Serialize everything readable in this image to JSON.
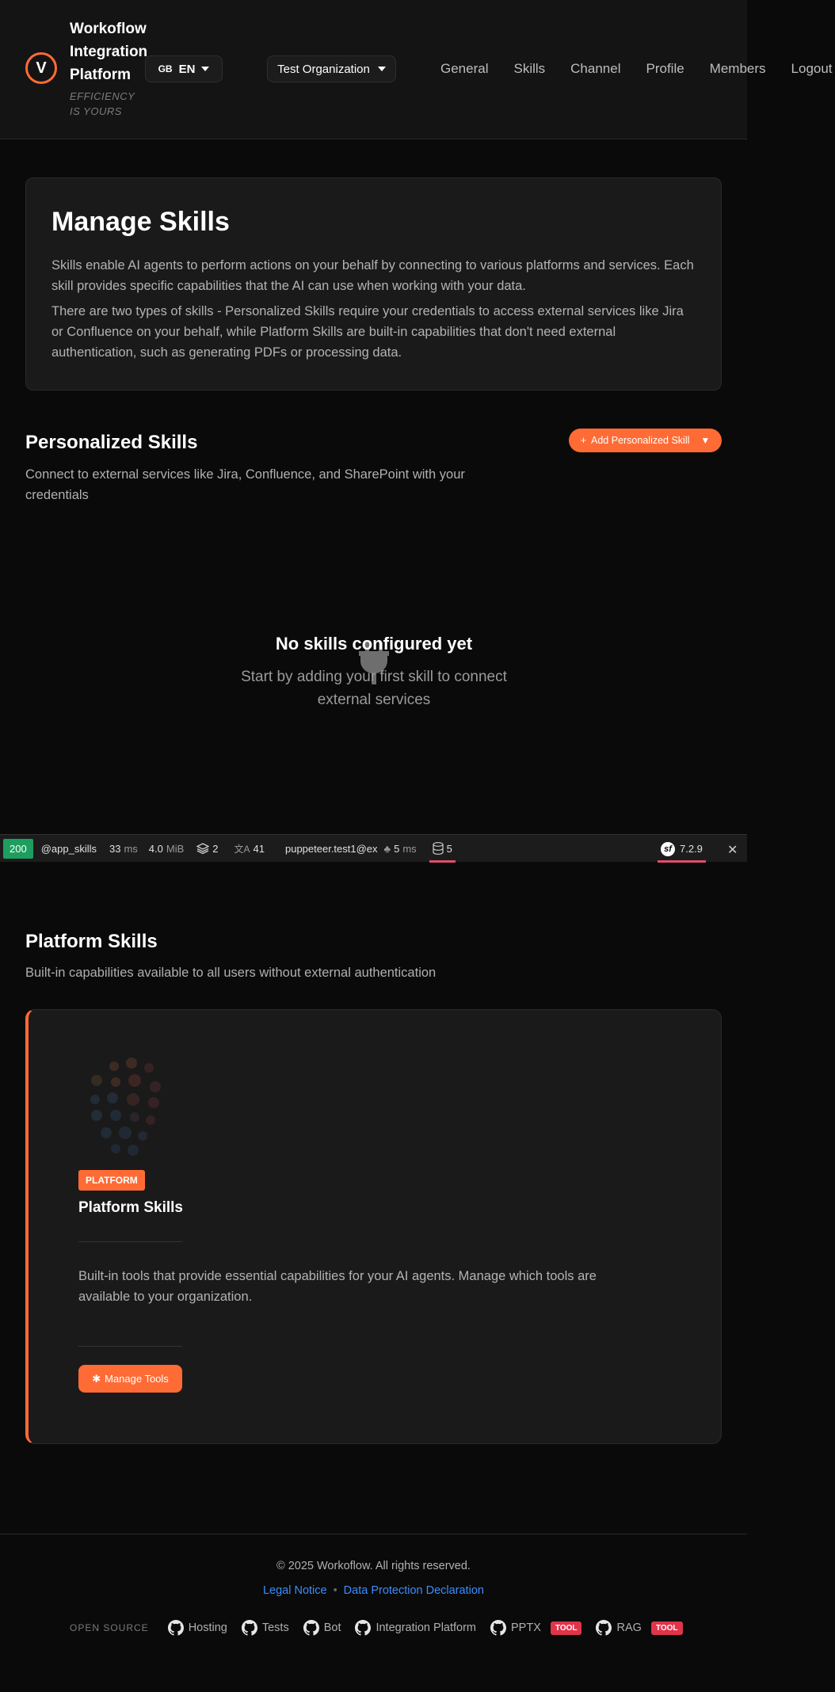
{
  "header": {
    "logo_letter": "V",
    "brand": "Workoflow Integration Platform",
    "tagline": "EFFICIENCY IS YOURS",
    "language": {
      "flag": "GB",
      "code": "EN"
    },
    "organization": "Test Organization",
    "nav": [
      "General",
      "Skills",
      "Channel",
      "Profile",
      "Members",
      "Logout"
    ]
  },
  "intro": {
    "title": "Manage Skills",
    "p1": "Skills enable AI agents to perform actions on your behalf by connecting to various platforms and services. Each skill provides specific capabilities that the AI can use when working with your data.",
    "p2": "There are two types of skills - Personalized Skills require your credentials to access external services like Jira or Confluence on your behalf, while Platform Skills are built-in capabilities that don't need external authentication, such as generating PDFs or processing data."
  },
  "personalized": {
    "title": "Personalized Skills",
    "description": "Connect to external services like Jira, Confluence, and SharePoint with your credentials",
    "add_button": "Add Personalized Skill",
    "empty_title": "No skills configured yet",
    "empty_desc": "Start by adding your first skill to connect external services"
  },
  "toolbar": {
    "status": "200",
    "route": "@app_skills",
    "time": "33",
    "time_unit": "ms",
    "memory": "4.0",
    "memory_unit": "MiB",
    "layers": "2",
    "translations": "41",
    "user": "puppeteer.test1@ex",
    "events_time": "5",
    "events_unit": "ms",
    "db": "5",
    "version": "7.2.9"
  },
  "platform": {
    "title": "Platform Skills",
    "description": "Built-in capabilities available to all users without external authentication",
    "card": {
      "badge": "PLATFORM",
      "title": "Platform Skills",
      "description": "Built-in tools that provide essential capabilities for your AI agents. Manage which tools are available to your organization.",
      "button": "Manage Tools"
    }
  },
  "footer": {
    "copyright": "© 2025 Workoflow. All rights reserved.",
    "legal_notice": "Legal Notice",
    "dot": "•",
    "data_protection": "Data Protection Declaration",
    "open_source_label": "OPEN SOURCE",
    "repos": [
      {
        "name": "Hosting",
        "badge": ""
      },
      {
        "name": "Tests",
        "badge": ""
      },
      {
        "name": "Bot",
        "badge": ""
      },
      {
        "name": "Integration Platform",
        "badge": ""
      },
      {
        "name": "PPTX",
        "badge": "TOOL"
      },
      {
        "name": "RAG",
        "badge": "TOOL"
      }
    ]
  },
  "colors": {
    "accent": "#ff6b35",
    "link": "#3b8cff",
    "status_ok": "#1e9e5e",
    "tool_badge": "#e0344b"
  }
}
